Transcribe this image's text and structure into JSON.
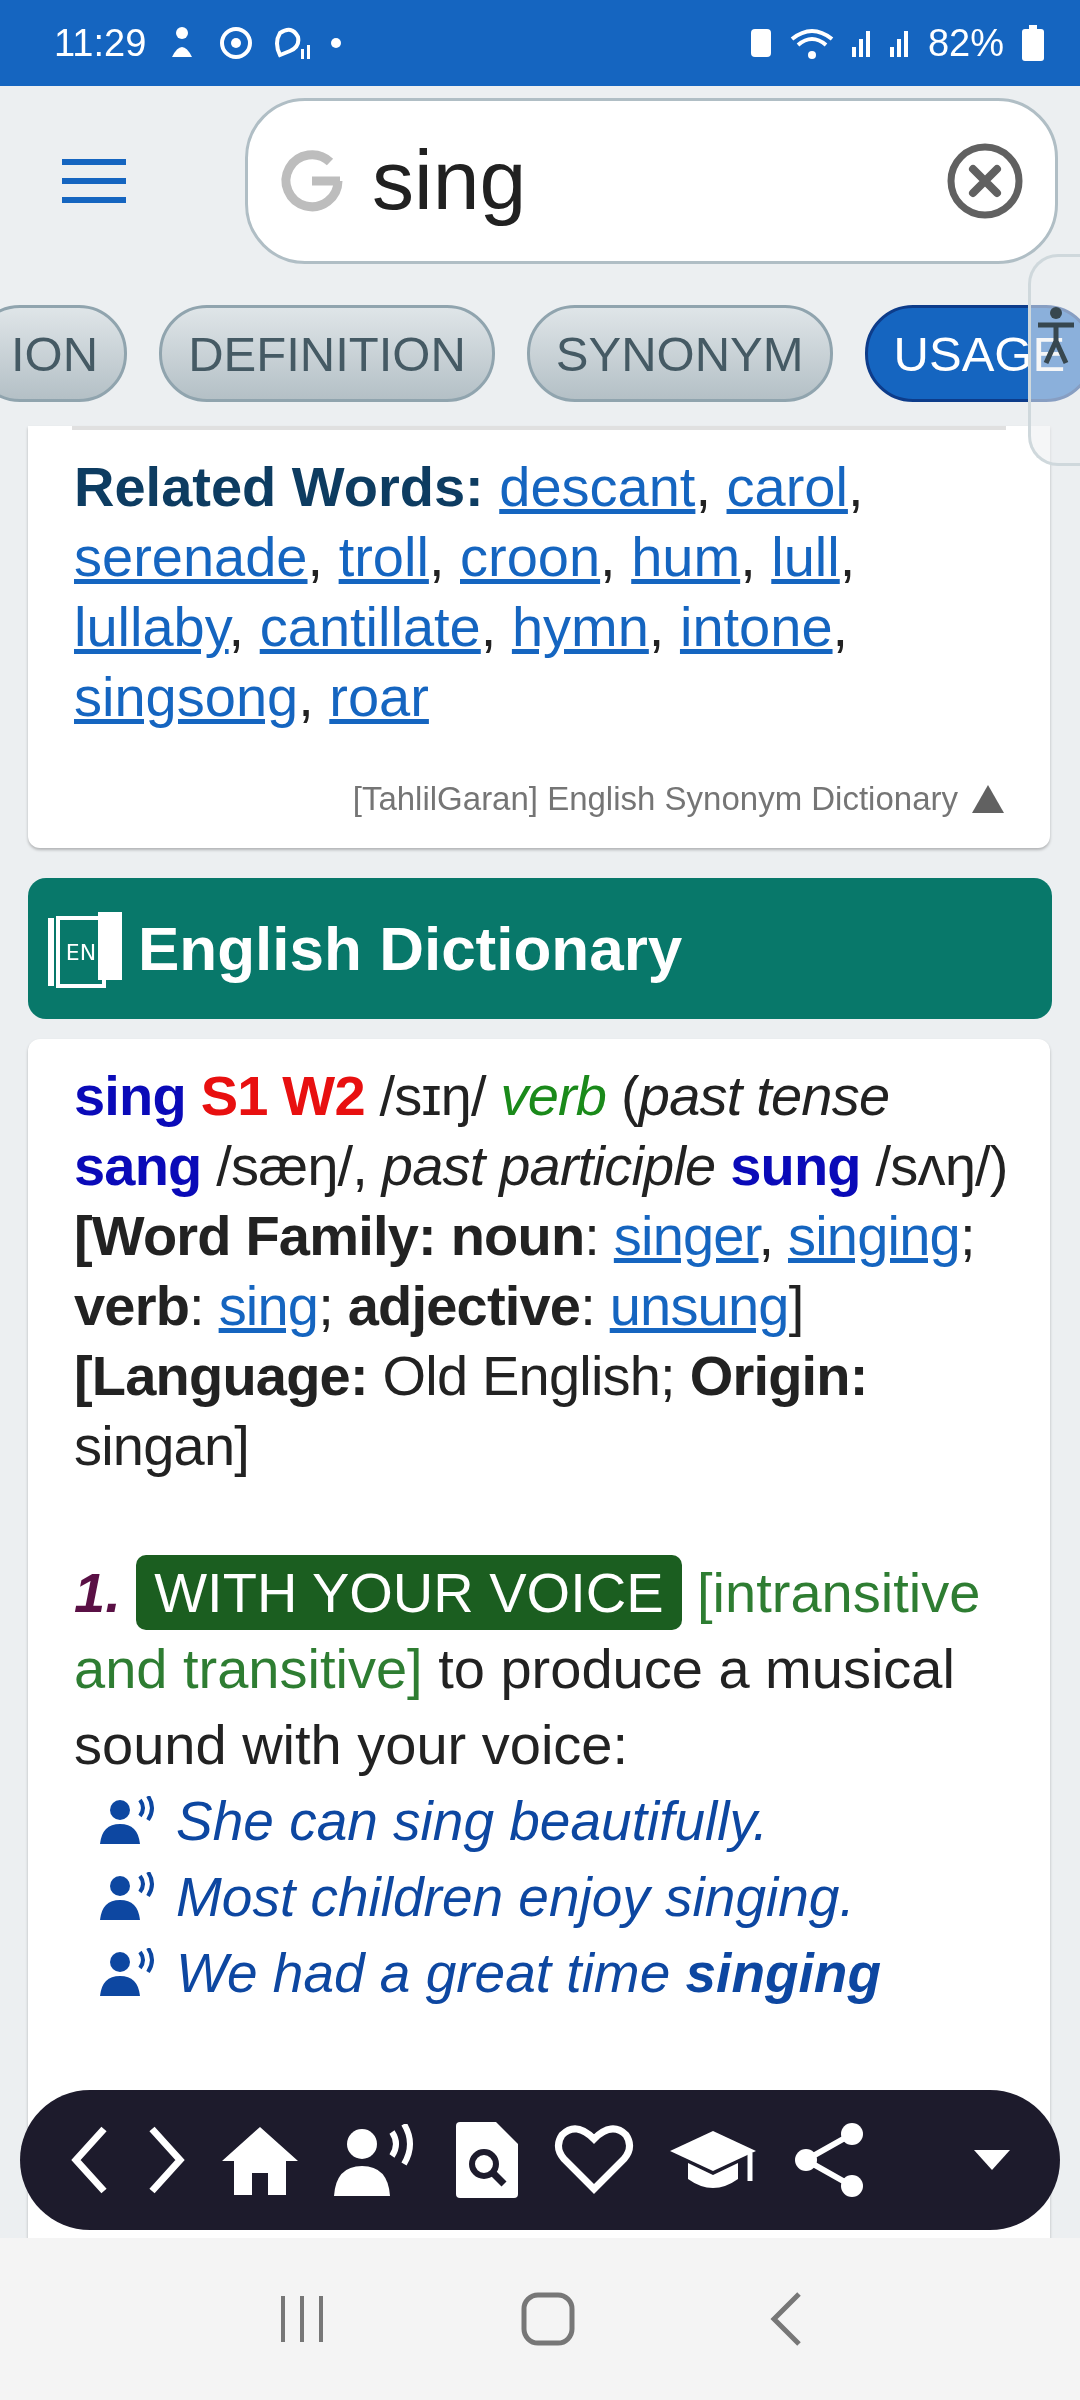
{
  "status_bar": {
    "time": "11:29",
    "battery": "82%"
  },
  "search": {
    "value": "sing"
  },
  "tabs": [
    {
      "label": "ION",
      "selected": false
    },
    {
      "label": "DEFINITION",
      "selected": false
    },
    {
      "label": "SYNONYM",
      "selected": false
    },
    {
      "label": "USAGE",
      "selected": true
    }
  ],
  "synonyms": {
    "label": "Related Words:",
    "words": [
      {
        "text": "descant",
        "sep": ","
      },
      {
        "text": "carol",
        "sep": ","
      },
      {
        "text": "serenade",
        "sep": ","
      },
      {
        "text": "troll",
        "sep": ","
      },
      {
        "text": "croon",
        "sep": ","
      },
      {
        "text": "hum",
        "sep": ","
      },
      {
        "text": "lull",
        "sep": ","
      },
      {
        "text": "lullaby",
        "sep": ","
      },
      {
        "text": "cantillate",
        "sep": ","
      },
      {
        "text": "hymn",
        "sep": ","
      },
      {
        "text": "intone",
        "sep": ","
      },
      {
        "text": "singsong",
        "sep": ","
      },
      {
        "text": "roar"
      }
    ],
    "source": "[TahlilGaran] English Synonym Dictionary"
  },
  "dictionary": {
    "title": "English Dictionary",
    "icon_label": "EN",
    "paragraphs": [
      {
        "segments": [
          {
            "kind": "head",
            "text": "sing"
          },
          {
            "kind": "code",
            "text": " S1 W2"
          },
          {
            "kind": "plain",
            "text": " /sɪŋ/ "
          },
          {
            "kind": "pos",
            "text": "verb"
          },
          {
            "kind": "plain",
            "text": " ("
          },
          {
            "kind": "italic",
            "text": "past tense"
          },
          {
            "kind": "head",
            "text": " sang"
          },
          {
            "kind": "plain",
            "text": " /sæŋ/, "
          },
          {
            "kind": "italic",
            "text": "past participle"
          },
          {
            "kind": "head",
            "text": " sung"
          },
          {
            "kind": "plain",
            "text": " /sʌŋ/)"
          }
        ]
      },
      {
        "segments": [
          {
            "kind": "bold",
            "text": "[Word Family: noun"
          },
          {
            "kind": "plain",
            "text": ": "
          },
          {
            "kind": "link",
            "text": "singer"
          },
          {
            "kind": "plain",
            "text": ", "
          },
          {
            "kind": "link",
            "text": "singing"
          },
          {
            "kind": "plain",
            "text": "; "
          },
          {
            "kind": "bold",
            "text": "verb"
          },
          {
            "kind": "plain",
            "text": ": "
          },
          {
            "kind": "link",
            "text": "sing"
          },
          {
            "kind": "plain",
            "text": "; "
          },
          {
            "kind": "bold",
            "text": "adjective"
          },
          {
            "kind": "plain",
            "text": ": "
          },
          {
            "kind": "link",
            "text": "unsung"
          },
          {
            "kind": "plain",
            "text": "]"
          }
        ]
      },
      {
        "segments": [
          {
            "kind": "bold",
            "text": "[Language:"
          },
          {
            "kind": "plain",
            "text": " Old English; "
          },
          {
            "kind": "bold",
            "text": "Origin:"
          },
          {
            "kind": "plain",
            "text": " singan]"
          }
        ]
      }
    ],
    "sense": {
      "number": "1.",
      "label": "WITH YOUR VOICE",
      "grammar": "[intransitive and transitive]",
      "definition": "to produce a musical sound with your voice:",
      "examples": [
        "She can sing beautifully.",
        "Most children enjoy singing.",
        "We had a great time **singing**"
      ]
    }
  }
}
